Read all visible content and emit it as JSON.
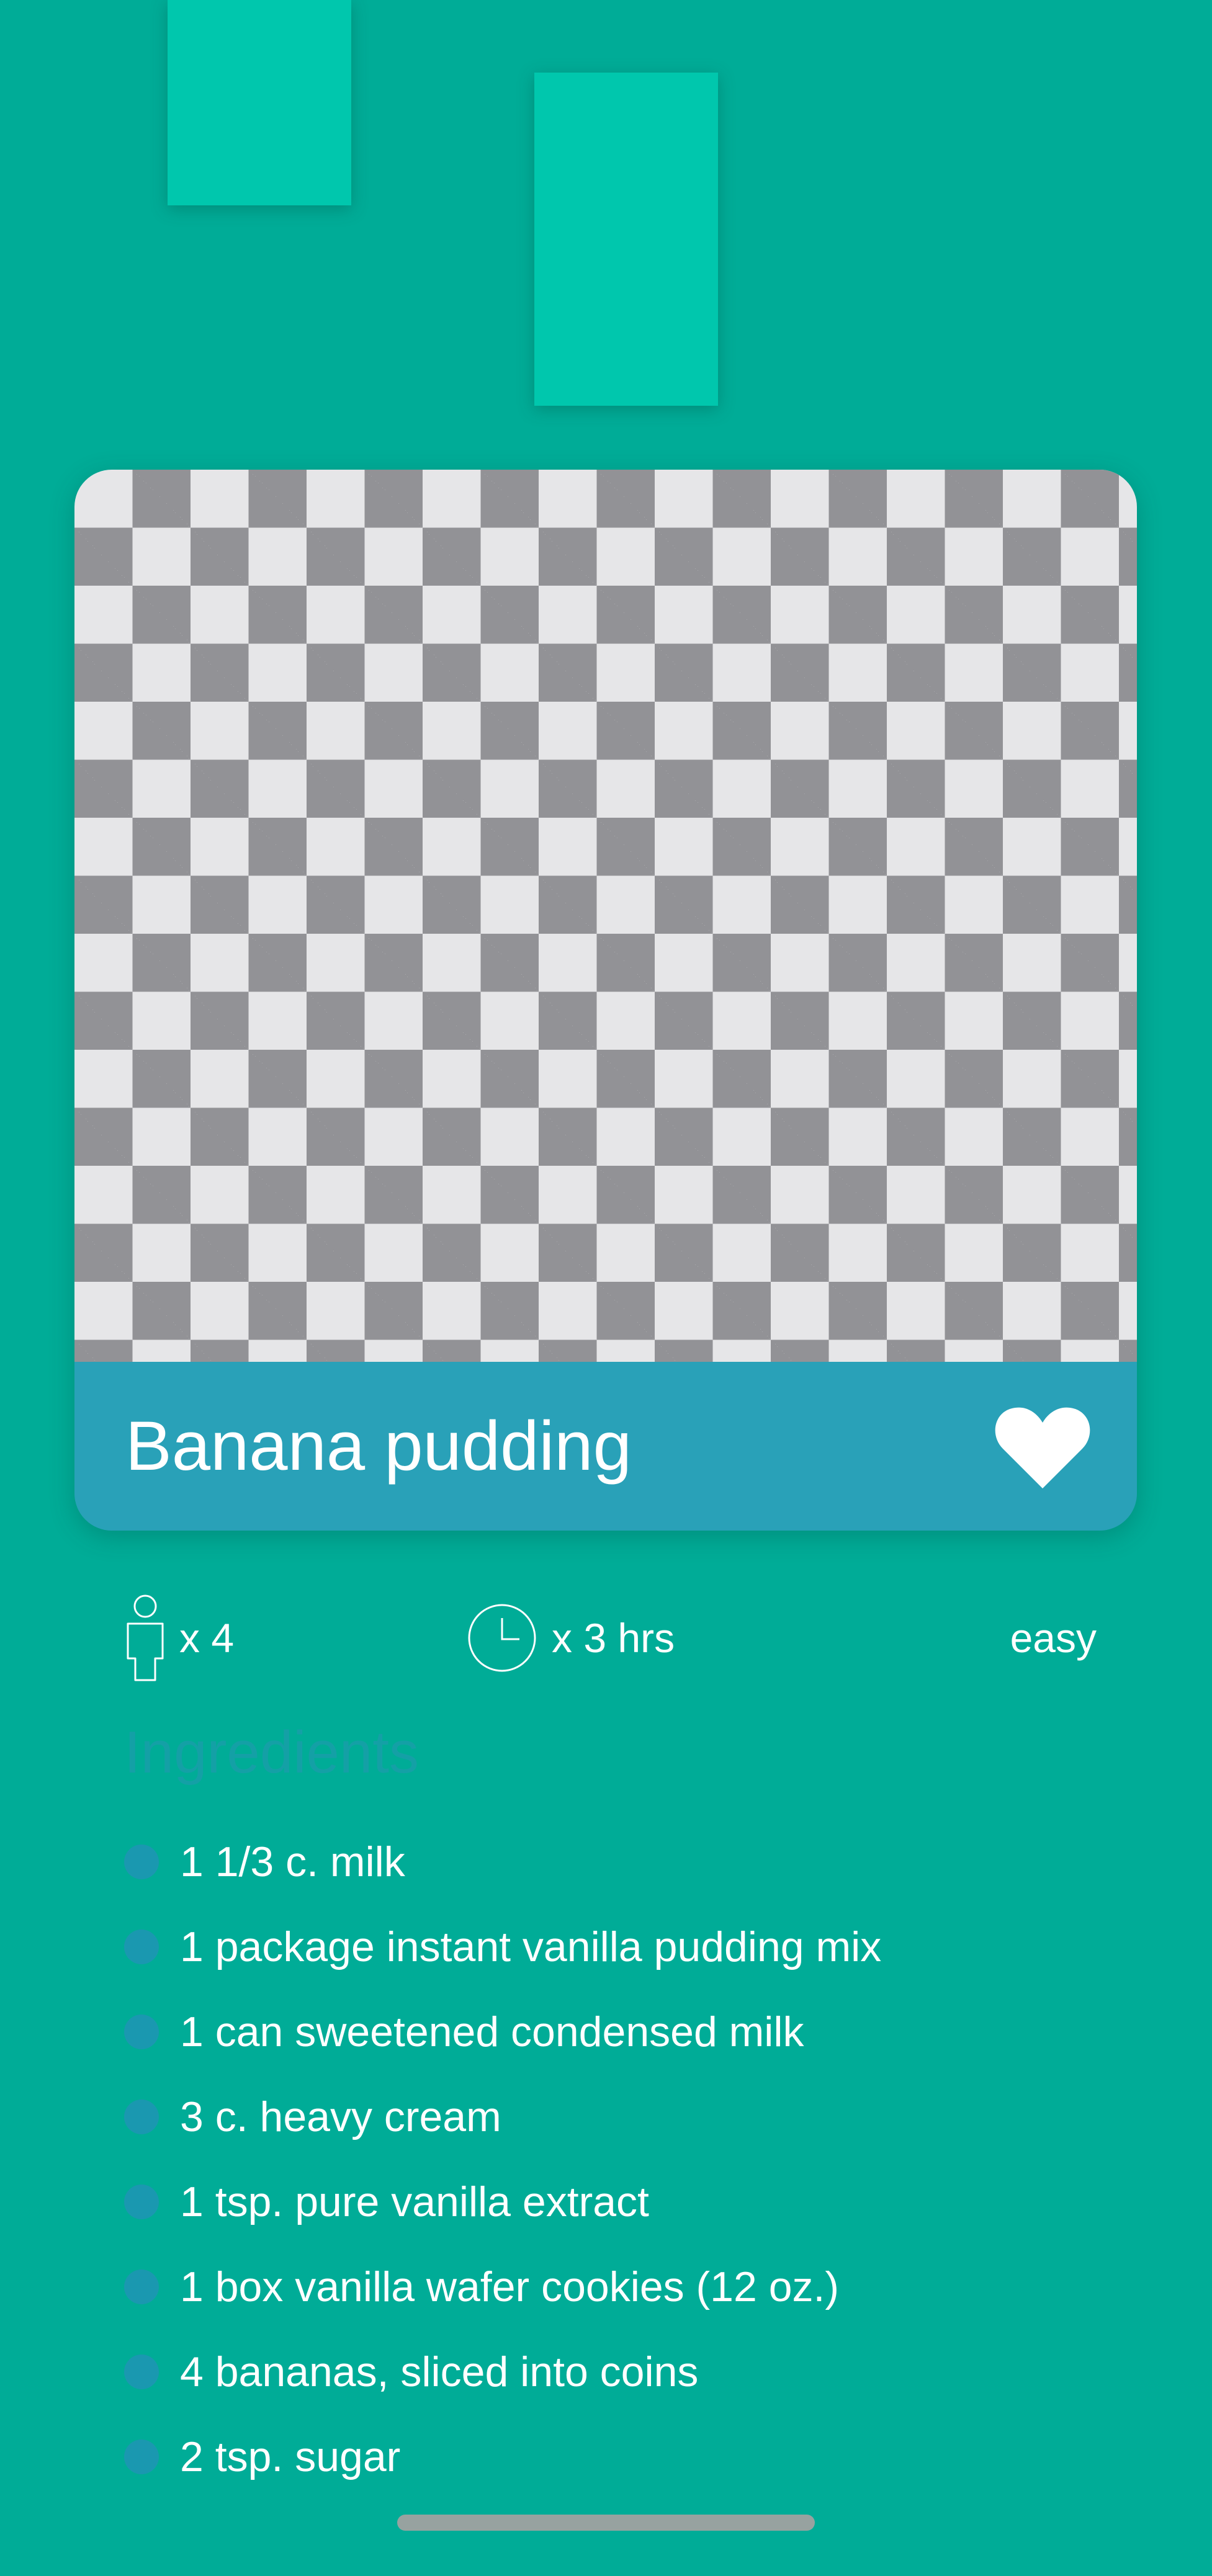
{
  "recipe": {
    "title": "Banana pudding",
    "favorited": true
  },
  "meta": {
    "servings": "x 4",
    "time": "x 3 hrs",
    "difficulty": "easy"
  },
  "ingredients": {
    "heading": "Ingredients",
    "items": [
      "1 1/3 c. milk",
      "1 package instant vanilla pudding mix",
      "1 can sweetened condensed milk",
      "3 c. heavy cream",
      "1 tsp. pure vanilla extract",
      "1 box vanilla wafer cookies (12 oz.)",
      "4 bananas, sliced into coins",
      "2 tsp. sugar"
    ]
  },
  "icons": {
    "servings": "person-icon",
    "time": "clock-icon",
    "favorite": "heart-icon"
  },
  "colors": {
    "background": "#00ac97",
    "title_bar": "#29a1b8",
    "decor": "#00c7ad",
    "bullet": "#1a98b0",
    "heading": "#14a0a6"
  }
}
